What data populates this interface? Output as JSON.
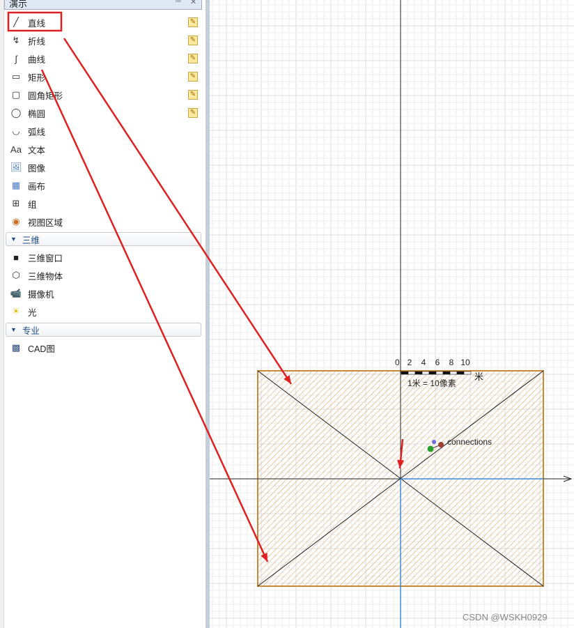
{
  "panel": {
    "title": "演示"
  },
  "items": [
    {
      "label": "直线",
      "icon": "line-icon",
      "pencil": true
    },
    {
      "label": "折线",
      "icon": "polyline-icon",
      "pencil": true
    },
    {
      "label": "曲线",
      "icon": "curve-icon",
      "pencil": true
    },
    {
      "label": "矩形",
      "icon": "rectangle-icon",
      "pencil": true
    },
    {
      "label": "圆角矩形",
      "icon": "rounded-rectangle-icon",
      "pencil": true
    },
    {
      "label": "椭圆",
      "icon": "ellipse-icon",
      "pencil": true
    },
    {
      "label": "弧线",
      "icon": "arc-icon"
    },
    {
      "label": "文本",
      "icon": "text-icon"
    },
    {
      "label": "图像",
      "icon": "image-icon"
    },
    {
      "label": "画布",
      "icon": "canvas-icon"
    },
    {
      "label": "组",
      "icon": "group-icon"
    },
    {
      "label": "视图区域",
      "icon": "view-area-icon"
    }
  ],
  "sections": [
    {
      "label": "三维",
      "items": [
        {
          "label": "三维窗口",
          "icon": "3d-window-icon"
        },
        {
          "label": "三维物体",
          "icon": "3d-object-icon"
        },
        {
          "label": "摄像机",
          "icon": "camera-icon"
        },
        {
          "label": "光",
          "icon": "light-icon"
        }
      ]
    },
    {
      "label": "专业",
      "items": [
        {
          "label": "CAD图",
          "icon": "cad-icon"
        }
      ]
    }
  ],
  "canvas": {
    "scale_ticks": [
      "0",
      "2",
      "4",
      "6",
      "8",
      "10"
    ],
    "scale_unit": "米",
    "scale_text": "1米 = 10像素",
    "connections_label": "connections",
    "colors": {
      "rect_border": "#c8893a",
      "hatch": "#e0a870",
      "axis_blue": "#3a8ad8",
      "annotation": "#e02020"
    }
  },
  "watermark": "CSDN @WSKH0929"
}
